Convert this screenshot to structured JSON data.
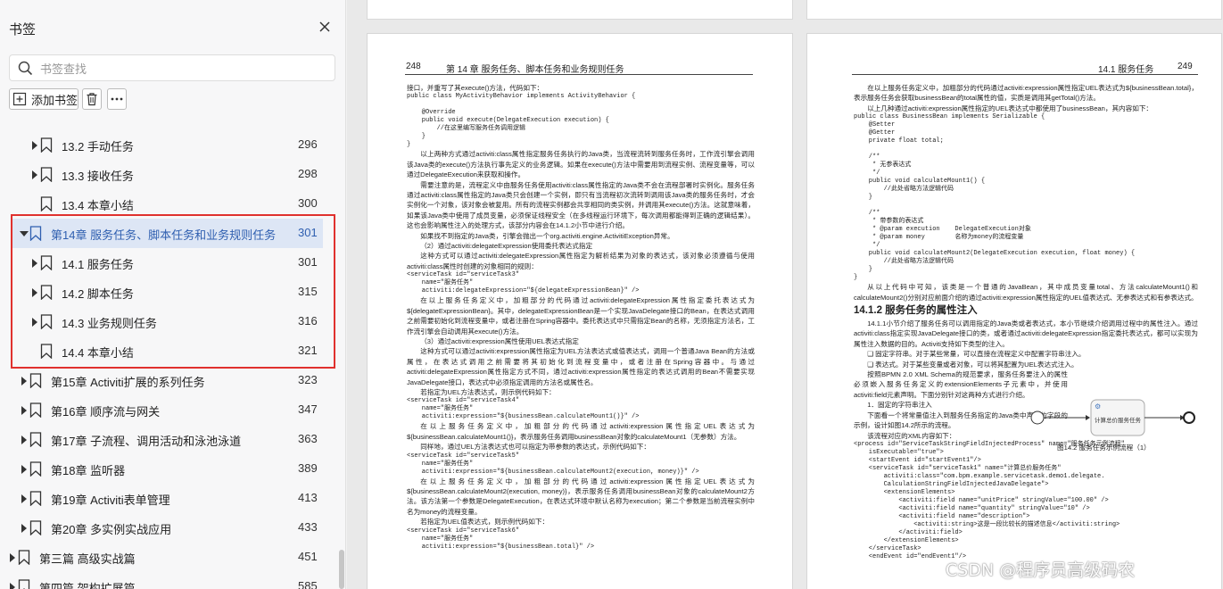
{
  "sidebar": {
    "title": "书签",
    "search_placeholder": "书签查找",
    "add_label": "添加书签",
    "items": [
      {
        "label": "13.2  手动任务",
        "page": "296"
      },
      {
        "label": "13.3  接收任务",
        "page": "298"
      },
      {
        "label": "13.4  本章小结",
        "page": "300"
      },
      {
        "label": "第14章  服务任务、脚本任务和业务规则任务",
        "page": "301"
      },
      {
        "label": "14.1  服务任务",
        "page": "301"
      },
      {
        "label": "14.2  脚本任务",
        "page": "315"
      },
      {
        "label": "14.3  业务规则任务",
        "page": "316"
      },
      {
        "label": "14.4  本章小结",
        "page": "321"
      },
      {
        "label": "第15章  Activiti扩展的系列任务",
        "page": "323"
      },
      {
        "label": "第16章  顺序流与网关",
        "page": "347"
      },
      {
        "label": "第17章  子流程、调用活动和泳池泳道",
        "page": "363"
      },
      {
        "label": "第18章  监听器",
        "page": "389"
      },
      {
        "label": "第19章  Activiti表单管理",
        "page": "413"
      },
      {
        "label": "第20章  多实例实战应用",
        "page": "433"
      },
      {
        "label": "第三篇  高级实战篇",
        "page": "451"
      },
      {
        "label": "第四篇  架构扩展篇",
        "page": "585"
      }
    ]
  },
  "left_page": {
    "page_number": "248",
    "chapter_header": "第 14 章   服务任务、脚本任务和业务规则任务",
    "p1": "接口，并重写了其execute()方法，代码如下：",
    "code1": "public class MyActivityBehavior implements ActivityBehavior {\n\n    @Override\n    public void execute(DelegateExecution execution) {\n        //在这里编写服务任务调用逻辑\n    }\n}",
    "p2": "以上两种方式通过activiti:class属性指定服务任务执行的Java类，当流程流转到服务任务时，工作流引擎会调用该Java类的execute()方法执行事先定义的业务逻辑。如果在execute()方法中需要用到流程实例、流程变量等，可以通过DelegateExecution来获取和操作。",
    "p3": "需要注意的是，流程定义中由服务任务使用activiti:class属性指定的Java类不会在流程部署时实例化。服务任务通过activiti:class属性指定的Java类只会创建一个实例，即只有当流程初次流转到调用该Java类的服务任务时，才会实例化一个对象，该对象会被复用。所有的流程实例都会共享相同的类实例，并调用其execute()方法。这就意味着，如果该Java类中使用了成员变量，必须保证线程安全（在多线程运行环境下，每次调用都能得到正确的逻辑结果）。这也会影响属性注入的处理方式，该部分内容会在14.1.2小节中进行介绍。",
    "p4": "如果找不到指定的Java类，引擎会抛出一个org.activiti.engine.ActivitiException异常。",
    "h2": "（2）通过activiti:delegateExpression使用委托表达式指定",
    "p5": "这种方式可以通过activiti:delegateExpression属性指定为解析结果为对象的表达式，该对象必须遵循与使用activiti:class属性时创建的对象相同的规则：",
    "code2": "<serviceTask id=\"serviceTask3\"\n    name=\"服务任务\"\n    activiti:delegateExpression=\"${delegateExpressionBean}\" />",
    "p6": "在以上服务任务定义中，加粗部分的代码通过activiti:delegateExpression属性指定委托表达式为${delegateExpressionBean}。其中，delegateExpressionBean是一个实现JavaDelegate接口的Bean，在表达式调用之前需要初始化到流程变量中，或者注册在Spring容器中。委托表达式中只需指定Bean的名称，无须指定方法名，工作流引擎会自动调用其execute()方法。",
    "h3": "（3）通过activiti:expression属性使用UEL表达式指定",
    "p7": "这种方式可以通过activiti:expression属性指定为UEL方法表达式或值表达式，调用一个普通Java Bean的方法或属性，在表达式调用之前需要将其初始化到流程变量中，或者注册在Spring容器中。与通过activiti:delegateExpression属性指定方式不同，通过activiti:expression属性指定的表达式调用的Bean不需要实现JavaDelegate接口，表达式中必须指定调用的方法名或属性名。",
    "p8": "若指定为UEL方法表达式，则示例代码如下：",
    "code3": "<serviceTask id=\"serviceTask4\"\n    name=\"服务任务\"\n    activiti:expression=\"${businessBean.calculateMount1()}\" />",
    "p9": "在以上服务任务定义中，加粗部分的代码通过activiti:expression属性指定UEL表达式为${businessBean.calculateMount1()}，表示服务任务调用businessBean对象的calculateMount1（无参数）方法。",
    "p10": "同样地，通过UEL方法表达式也可以指定为带参数的表达式，示例代码如下：",
    "code4": "<serviceTask id=\"serviceTask5\"\n    name=\"服务任务\"\n    activiti:expression=\"${businessBean.calculateMount2(execution, money)}\" />",
    "p11": "在以上服务任务定义中，加粗部分的代码通过activiti:expression属性指定UEL表达式为${businessBean.calculateMount2(execution, money)}，表示服务任务调用businessBean对象的calculateMount2方法。该方法第一个参数是DelegateExecution，在表达式环境中默认名称为execution；第二个参数是当前流程实例中名为money的流程变量。",
    "p12": "若指定为UEL值表达式，则示例代码如下：",
    "code5": "<serviceTask id=\"serviceTask6\"\n    name=\"服务任务\"\n    activiti:expression=\"${businessBean.total}\" />"
  },
  "right_page": {
    "page_number": "249",
    "section_header": "14.1   服务任务",
    "p1": "在以上服务任务定义中，加粗部分的代码通过activiti:expression属性指定UEL表达式为${businessBean.total}，表示服务任务会获取businessBean的total属性的值，实质是调用其getTotal()方法。",
    "p2": "以上几种通过activiti:expression属性指定的UEL表达式中都使用了businessBean，其内容如下：",
    "code1": "public class BusinessBean implements Serializable {\n    @Setter\n    @Getter\n    private float total;\n\n    /**\n     * 无参表达式\n     */\n    public void calculateMount1() {\n        //此处省略方法逻辑代码\n    }\n\n    /**\n     * 带参数的表达式\n     * @param execution    DelegateExecution对象\n     * @param money        名称为money的流程变量\n     */\n    public void calculateMount2(DelegateExecution execution, float money) {\n        //此处省略方法逻辑代码\n    }\n}",
    "p3": "从以上代码中可知，该类是一个普通的JavaBean，其中成员变量total、方法calculateMount1()和calculateMount2()分别对应前面介绍的通过activiti:expression属性指定的UEL值表达式、无参表达式和有参表达式。",
    "h2": "14.1.2   服务任务的属性注入",
    "p4": "14.1.1小节介绍了服务任务可以调用指定的Java类或者表达式，本小节继续介绍调用过程中的属性注入。通过activiti:class指定实现JavaDelegate接口的类，或者通过activiti:delegateExpression指定委托表达式，都可以实现为属性注入数据的目的。Activiti支持如下类型的注入。",
    "b1": "❑ 固定字符串。对于某些常量，可以直接在流程定义中配置字符串注入。",
    "b2": "❑ 表达式。对于某些变量或者对象，可以将其配置为UEL表达式注入。",
    "p5": "按照BPMN 2.0 XML Schema的规范要求，服务任务要注入的属性必须嵌入服务任务定义的extensionElements子元素中，并使用activiti:field元素声明。下面分别针对这两种方式进行介绍。",
    "h3": "1．固定的字符串注入",
    "p6": "下面看一个将常量值注入到服务任务指定的Java类中声明的字段的示例，设计如图14.2所示的流程。",
    "p7": "该流程对应的XML内容如下：",
    "diagram_label": "计算总价服务任务",
    "fig_caption": "图14.2   服务任务示例流程（1）",
    "code2": "<process id=\"ServiceTaskStringFieldInjectedProcess\" name=\"服务任务示例流程\"\n    isExecutable=\"true\">\n    <startEvent id=\"startEvent1\"/>\n    <serviceTask id=\"serviceTask1\" name=\"计算总价服务任务\"\n        activiti:class=\"com.bpm.example.servicetask.demo1.delegate.\n        CalculationStringFieldInjectedJavaDelegate\">\n        <extensionElements>\n            <activiti:field name=\"unitPrice\" stringValue=\"100.00\" />\n            <activiti:field name=\"quantity\" stringValue=\"10\" />\n            <activiti:field name=\"description\">\n                <activiti:string>这是一段比较长的描述信息</activiti:string>\n            </activiti:field>\n        </extensionElements>\n    </serviceTask>\n    <endEvent id=\"endEvent1\"/>"
  },
  "watermark": "CSDN @程序员高级码农",
  "colors": {
    "accent": "#2f5fb0",
    "highlight_border": "#e0312e",
    "selected_bg": "#dde6f5"
  }
}
